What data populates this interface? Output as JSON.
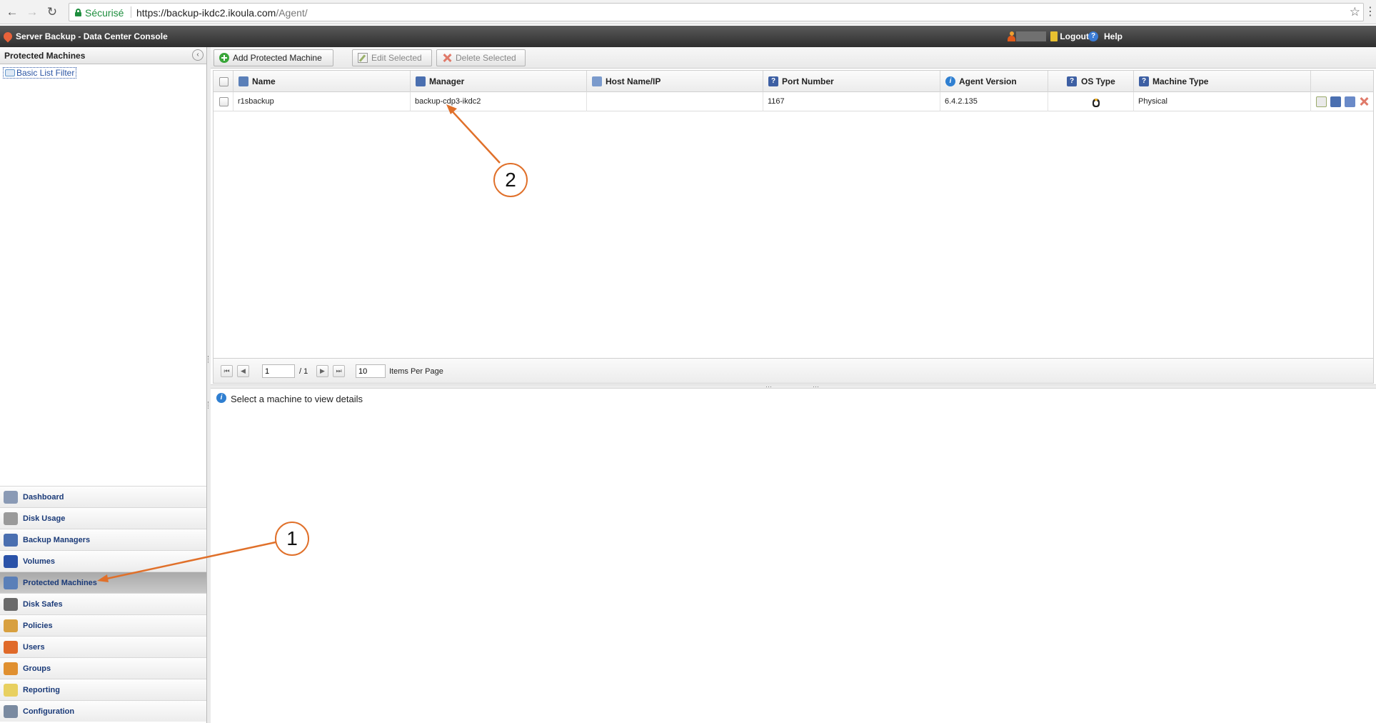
{
  "browser": {
    "secure_label": "Sécurisé",
    "url_host": "https://backup-ikdc2.ikoula.com",
    "url_path": "/Agent/"
  },
  "header": {
    "title": "Server Backup - Data Center Console",
    "logout_label": "Logout",
    "help_label": "Help"
  },
  "left_panel": {
    "title": "Protected Machines",
    "filter_label": "Basic List Filter"
  },
  "nav": [
    {
      "label": "Dashboard",
      "icon": "dashboard-icon",
      "color": "#8a9ab5",
      "active": false
    },
    {
      "label": "Disk Usage",
      "icon": "disk-usage-icon",
      "color": "#9a9a9a",
      "active": false
    },
    {
      "label": "Backup Managers",
      "icon": "backup-managers-icon",
      "color": "#4a6fb0",
      "active": false
    },
    {
      "label": "Volumes",
      "icon": "volumes-icon",
      "color": "#2a52a8",
      "active": false
    },
    {
      "label": "Protected Machines",
      "icon": "protected-machines-icon",
      "color": "#5a7fb8",
      "active": true
    },
    {
      "label": "Disk Safes",
      "icon": "disk-safes-icon",
      "color": "#6a6a6a",
      "active": false
    },
    {
      "label": "Policies",
      "icon": "policies-icon",
      "color": "#d8a040",
      "active": false
    },
    {
      "label": "Users",
      "icon": "users-icon",
      "color": "#e06a2a",
      "active": false
    },
    {
      "label": "Groups",
      "icon": "groups-icon",
      "color": "#e09030",
      "active": false
    },
    {
      "label": "Reporting",
      "icon": "reporting-icon",
      "color": "#e8d060",
      "active": false
    },
    {
      "label": "Configuration",
      "icon": "configuration-icon",
      "color": "#7a8aa0",
      "active": false
    }
  ],
  "toolbar": {
    "add_label": "Add Protected Machine",
    "edit_label": "Edit Selected",
    "delete_label": "Delete Selected"
  },
  "grid": {
    "columns": [
      "Name",
      "Manager",
      "Host Name/IP",
      "Port Number",
      "Agent Version",
      "OS Type",
      "Machine Type"
    ],
    "rows": [
      {
        "name": "r1sbackup",
        "manager": "backup-cdp3-ikdc2",
        "host": "",
        "port": "1167",
        "agent_version": "6.4.2.135",
        "os_type": "linux-penguin-icon",
        "machine_type": "Physical"
      }
    ]
  },
  "pager": {
    "page": "1",
    "total_pages": "/ 1",
    "per_page": "10",
    "per_page_label": "Items Per Page"
  },
  "details": {
    "message": "Select a machine to view details"
  },
  "annotations": {
    "callout_1": "1",
    "callout_2": "2",
    "color": "#e0702a"
  }
}
